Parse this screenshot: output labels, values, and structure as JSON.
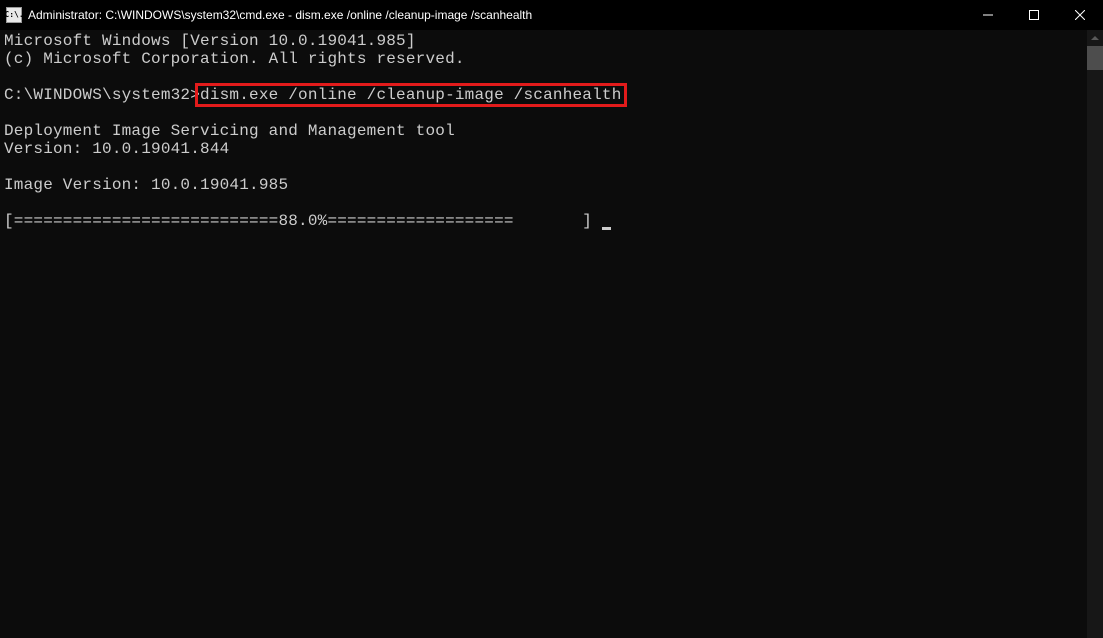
{
  "titlebar": {
    "icon_label": "C:\\.",
    "title": "Administrator: C:\\WINDOWS\\system32\\cmd.exe - dism.exe  /online /cleanup-image /scanhealth"
  },
  "terminal": {
    "line1": "Microsoft Windows [Version 10.0.19041.985]",
    "line2": "(c) Microsoft Corporation. All rights reserved.",
    "blank1": "",
    "prompt_prefix": "C:\\WINDOWS\\system32>",
    "prompt_command": "dism.exe /online /cleanup-image /scanhealth",
    "blank2": "",
    "tool1": "Deployment Image Servicing and Management tool",
    "tool2": "Version: 10.0.19041.844",
    "blank3": "",
    "imgver": "Image Version: 10.0.19041.985",
    "blank4": "",
    "progress": "[===========================88.0%===================       ] "
  }
}
